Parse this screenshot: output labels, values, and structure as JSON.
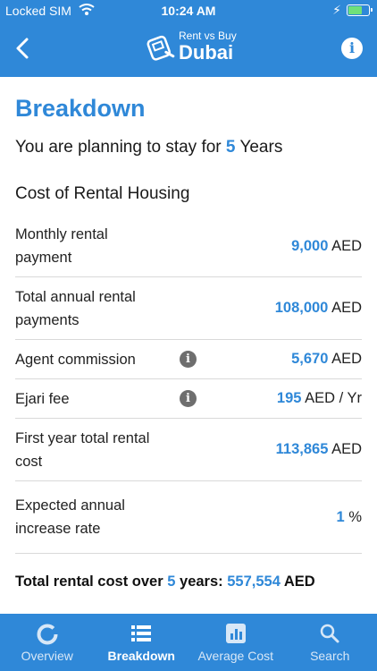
{
  "status": {
    "carrier": "Locked SIM",
    "time": "10:24 AM",
    "charging_glyph": "⚡"
  },
  "header": {
    "brand_small": "Rent vs Buy",
    "brand_big": "Dubai",
    "back_icon": "chevron-left-icon",
    "info_icon": "info-icon"
  },
  "page": {
    "title": "Breakdown",
    "stay_prefix": "You are planning to stay for",
    "stay_years": "5",
    "stay_suffix": "Years",
    "section_title": "Cost of Rental Housing"
  },
  "rows": [
    {
      "label_line1": "Monthly rental",
      "label_line2": "payment",
      "value": "9,000",
      "unit": "AED"
    },
    {
      "label_line1": "Total annual rental",
      "label_line2": "payments",
      "value": "108,000",
      "unit": "AED"
    },
    {
      "label_line1": "Agent commission",
      "label_line2": "",
      "value": "5,670",
      "unit": "AED",
      "has_info": true
    },
    {
      "label_line1": "Ejari fee",
      "label_line2": "",
      "value": "195",
      "unit": "AED / Yr",
      "has_info": true
    },
    {
      "label_line1": "First year total rental",
      "label_line2": "cost",
      "value": "113,865",
      "unit": "AED"
    },
    {
      "label_line1": "Expected annual",
      "label_line2": "increase rate",
      "value": "1",
      "unit": "%"
    }
  ],
  "total": {
    "prefix": "Total rental cost over",
    "years": "5",
    "mid": "years:",
    "amount": "557,554",
    "unit": "AED"
  },
  "tabs": [
    {
      "label": "Overview",
      "icon": "ring-icon"
    },
    {
      "label": "Breakdown",
      "icon": "list-icon",
      "active": true
    },
    {
      "label": "Average Cost",
      "icon": "bar-chart-icon"
    },
    {
      "label": "Search",
      "icon": "search-icon"
    }
  ],
  "colors": {
    "accent": "#2f88d8",
    "battery": "#6fe07a"
  }
}
